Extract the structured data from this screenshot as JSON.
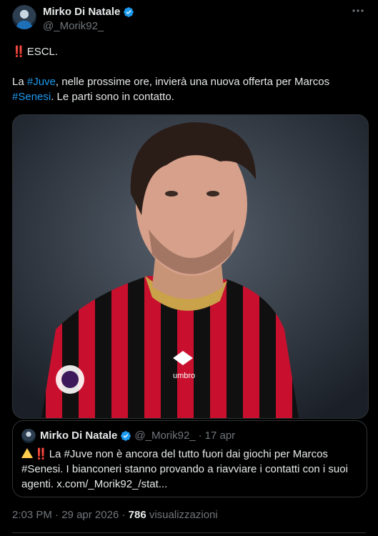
{
  "author": {
    "name": "Mirko Di Natale",
    "handle": "@_Morik92_"
  },
  "tweet": {
    "line1_prefix": "‼️",
    "line1_text": "ESCL.",
    "p2_a": "La ",
    "p2_tag1": "#Juve",
    "p2_b": ", nelle prossime ore, invierà una nuova offerta per Marcos ",
    "p2_tag2": "#Senesi",
    "p2_c": ". Le parti sono in contatto."
  },
  "media": {
    "alt": "Football player in red and black striped kit",
    "kit_brand": "umbro"
  },
  "quote": {
    "name": "Mirko Di Natale",
    "handle": "@_Morik92_",
    "separator": "·",
    "date": "17 apr",
    "text_a": "La ",
    "text_tag1": "#Juve",
    "text_b": " non è ancora del tutto fuori dai giochi per Marcos ",
    "text_tag2": "#Senesi",
    "text_c": ". I bianconeri stanno provando a riavviare i contatti con i suoi agenti. x.com/_Morik92_/stat..."
  },
  "meta": {
    "time": "2:03 PM",
    "sep1": "·",
    "date": "29 apr 2026",
    "sep2": "·",
    "views_count": "786",
    "views_label": "visualizzazioni"
  },
  "colors": {
    "background": "#000000",
    "text": "#e7e9ea",
    "muted": "#71767b",
    "link": "#1d9bf0",
    "verified": "#1d9bf0",
    "border": "#2f3336"
  },
  "icons": [
    "verified-badge-icon",
    "more-options-icon",
    "warning-icon",
    "double-exclamation-icon"
  ]
}
